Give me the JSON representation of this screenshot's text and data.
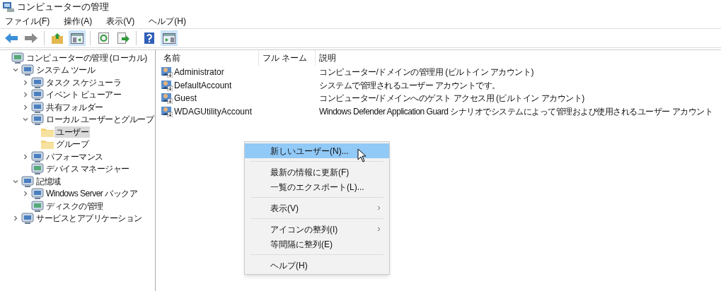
{
  "window": {
    "title": "コンピューターの管理"
  },
  "menu_bar": [
    "ファイル(F)",
    "操作(A)",
    "表示(V)",
    "ヘルプ(H)"
  ],
  "toolbar": [
    {
      "kind": "back",
      "pressed": false
    },
    {
      "kind": "forward",
      "pressed": false
    },
    {
      "kind": "separator"
    },
    {
      "kind": "up",
      "pressed": false
    },
    {
      "kind": "tree",
      "pressed": true
    },
    {
      "kind": "separator"
    },
    {
      "kind": "refresh",
      "pressed": false
    },
    {
      "kind": "export",
      "pressed": false
    },
    {
      "kind": "separator"
    },
    {
      "kind": "help",
      "pressed": false
    },
    {
      "kind": "action",
      "pressed": true
    }
  ],
  "tree": [
    {
      "label": "コンピューターの管理 (ローカル)",
      "selected": false,
      "children": [
        {
          "label": "システム ツール",
          "expanded": true,
          "selected": false,
          "children": [
            {
              "label": "タスク スケジューラ",
              "expanded": false,
              "selected": false
            },
            {
              "label": "イベント ビューアー",
              "expanded": false,
              "selected": false
            },
            {
              "label": "共有フォルダー",
              "expanded": false,
              "selected": false
            },
            {
              "label": "ローカル ユーザーとグループ",
              "expanded": true,
              "selected": false,
              "children": [
                {
                  "label": "ユーザー",
                  "selected": true
                },
                {
                  "label": "グループ",
                  "selected": false
                }
              ]
            },
            {
              "label": "パフォーマンス",
              "expanded": false,
              "selected": false
            },
            {
              "label": "デバイス マネージャー",
              "selected": false
            }
          ]
        },
        {
          "label": "記憶域",
          "expanded": true,
          "selected": false,
          "children": [
            {
              "label": "Windows Server バックア",
              "expanded": false,
              "selected": false
            },
            {
              "label": "ディスクの管理",
              "selected": false
            }
          ]
        },
        {
          "label": "サービスとアプリケーション",
          "expanded": false,
          "selected": false
        }
      ]
    }
  ],
  "table": {
    "columns": [
      "名前",
      "フル ネーム",
      "説明"
    ],
    "rows": [
      {
        "name": "Administrator",
        "description": "コンピューター/ドメインの管理用 (ビルトイン アカウント)"
      },
      {
        "name": "DefaultAccount",
        "description": "システムで管理されるユーザー アカウントです。"
      },
      {
        "name": "Guest",
        "description": "コンピューター/ドメインへのゲスト アクセス用 (ビルトイン アカウント)"
      },
      {
        "name": "WDAGUtilityAccount",
        "description": "Windows Defender Application Guard シナリオでシステムによって管理および使用されるユーザー アカウント"
      }
    ]
  },
  "context_menu": [
    {
      "kind": "item",
      "label": "新しいユーザー(N)...",
      "selected": true,
      "submenu": false
    },
    {
      "kind": "separator"
    },
    {
      "kind": "item",
      "label": "最新の情報に更新(F)",
      "selected": false,
      "submenu": false
    },
    {
      "kind": "item",
      "label": "一覧のエクスポート(L)...",
      "selected": false,
      "submenu": false
    },
    {
      "kind": "separator"
    },
    {
      "kind": "item",
      "label": "表示(V)",
      "selected": false,
      "submenu": true
    },
    {
      "kind": "separator"
    },
    {
      "kind": "item",
      "label": "アイコンの整列(I)",
      "selected": false,
      "submenu": true
    },
    {
      "kind": "item",
      "label": "等間隔に整列(E)",
      "selected": false,
      "submenu": false
    },
    {
      "kind": "separator"
    },
    {
      "kind": "item",
      "label": "ヘルプ(H)",
      "selected": false,
      "submenu": false
    }
  ]
}
